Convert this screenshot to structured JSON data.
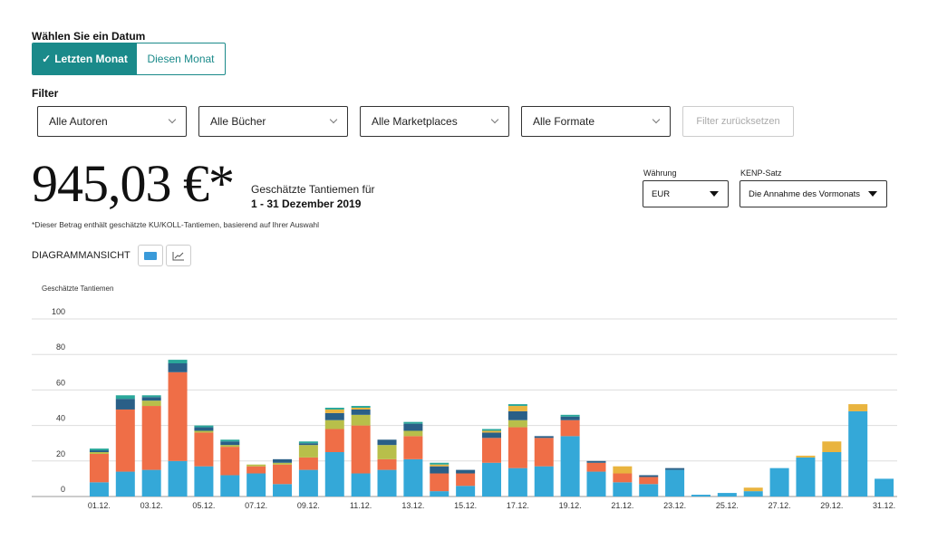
{
  "date_section": {
    "label": "Wählen Sie ein Datum",
    "options": [
      "Letzten Monat",
      "Diesen Monat"
    ],
    "selected": "Letzten Monat",
    "check": "✓"
  },
  "filter_section": {
    "label": "Filter",
    "authors": "Alle Autoren",
    "books": "Alle Bücher",
    "marketplaces": "Alle Marketplaces",
    "formats": "Alle Formate",
    "reset": "Filter zurücksetzen"
  },
  "summary": {
    "amount": "945,03 €*",
    "caption": "Geschätzte Tantiemen für",
    "period": "1 - 31 Dezember 2019",
    "note": "*Dieser Betrag enthält geschätzte KU/KOLL-Tantiemen, basierend auf Ihrer Auswahl"
  },
  "currency": {
    "label": "Währung",
    "value": "EUR"
  },
  "kenp": {
    "label": "KENP-Satz",
    "value": "Die Annahme des Vormonats"
  },
  "view": {
    "label": "DIAGRAMMANSICHT",
    "icons": [
      "bar-chart-icon",
      "line-chart-icon"
    ]
  },
  "colors": {
    "accent": "#1a8a8a",
    "blue": "#34a8d8",
    "orange": "#ef6e47",
    "olive": "#b8bf4a",
    "navy": "#2a5f87",
    "gold": "#e9b43f",
    "teal": "#2aa79a",
    "grid": "#dddddd"
  },
  "chart_data": {
    "type": "bar",
    "stacked": true,
    "ylabel": "Geschätzte Tantiemen",
    "ylim": [
      0,
      100
    ],
    "yticks": [
      0,
      20,
      40,
      60,
      80,
      100
    ],
    "grid": true,
    "categories": [
      "01.12.",
      "02.12.",
      "03.12.",
      "04.12.",
      "05.12.",
      "06.12.",
      "07.12.",
      "08.12.",
      "09.12.",
      "10.12.",
      "11.12.",
      "12.12.",
      "13.12.",
      "14.12.",
      "15.12.",
      "16.12.",
      "17.12.",
      "18.12.",
      "19.12.",
      "20.12.",
      "21.12.",
      "22.12.",
      "23.12.",
      "24.12.",
      "25.12.",
      "26.12.",
      "27.12.",
      "28.12.",
      "29.12.",
      "30.12.",
      "31.12."
    ],
    "xticklabels": [
      "01.12.",
      "03.12.",
      "05.12.",
      "07.12.",
      "09.12.",
      "11.12.",
      "13.12.",
      "15.12.",
      "17.12.",
      "19.12.",
      "21.12.",
      "23.12.",
      "25.12.",
      "27.12.",
      "29.12.",
      "31.12."
    ],
    "series": [
      {
        "color": "blue",
        "values": [
          8,
          14,
          15,
          20,
          17,
          12,
          13,
          7,
          15,
          25,
          13,
          15,
          21,
          3,
          6,
          19,
          16,
          17,
          34,
          14,
          8,
          7,
          15,
          1,
          2,
          3,
          16,
          22,
          25,
          48,
          10
        ]
      },
      {
        "color": "orange",
        "values": [
          16,
          35,
          36,
          50,
          19,
          16,
          4,
          11,
          7,
          13,
          27,
          6,
          13,
          10,
          7,
          14,
          23,
          16,
          9,
          5,
          5,
          4,
          0,
          0,
          0,
          0,
          0,
          0,
          0,
          0,
          0
        ]
      },
      {
        "color": "olive",
        "values": [
          1,
          0,
          3,
          0,
          1,
          1,
          1,
          1,
          7,
          5,
          6,
          8,
          3,
          0,
          0,
          0,
          4,
          0,
          0,
          0,
          0,
          0,
          0,
          0,
          0,
          0,
          0,
          0,
          0,
          0,
          0
        ]
      },
      {
        "color": "navy",
        "values": [
          1,
          6,
          2,
          5,
          2,
          2,
          0,
          2,
          1,
          4,
          3,
          3,
          4,
          4,
          2,
          3,
          5,
          1,
          2,
          1,
          0,
          1,
          1,
          0,
          0,
          0,
          0,
          0,
          0,
          0,
          0
        ]
      },
      {
        "color": "gold",
        "values": [
          0,
          0,
          0,
          0,
          0,
          0,
          0,
          0,
          0,
          2,
          1,
          0,
          0,
          1,
          0,
          1,
          3,
          0,
          0,
          0,
          4,
          0,
          0,
          0,
          0,
          2,
          0,
          1,
          6,
          4,
          0
        ]
      },
      {
        "color": "teal",
        "values": [
          1,
          2,
          1,
          2,
          1,
          1,
          0,
          0,
          1,
          1,
          1,
          0,
          1,
          1,
          0,
          1,
          1,
          0,
          1,
          0,
          0,
          0,
          0,
          0,
          0,
          0,
          0,
          0,
          0,
          0,
          0
        ]
      }
    ]
  }
}
